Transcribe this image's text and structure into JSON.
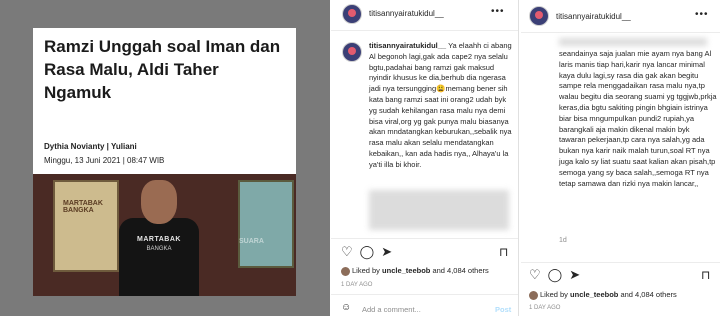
{
  "article": {
    "headline": "Ramzi Unggah soal Iman dan Rasa Malu, Aldi Taher Ngamuk",
    "byline": "Dythia Novianty | Yuliani",
    "date": "Minggu, 13 Juni 2021 | 08:47 WIB",
    "shirt_text": "MARTABAK",
    "shirt_sub": "BANGKA",
    "watermark": "SUARA",
    "poster_title": "MARTABAK BANGKA"
  },
  "post1": {
    "username": "titisannyairatukidul__",
    "caption_user": "titisannyairatukidul__",
    "caption": "Ya elaahh ci abang Al begonoh lagi,gak ada cape2 nya selalu bgtu,padahai bang ramzi gak maksud nyindir khusus ke dia,berhub dia ngerasa jadi nya tersungging😩memang bener sih kata bang ramzi saat ini orang2 udah byk yg sudah kehilangan rasa malu nya demi bisa viral,org yg gak punya malu biasanya akan mndatangkan keburukan,,sebalik nya rasa malu akan selalu mendatangkan kebaikan,, kan ada hadis nya,, Alhaya'u la ya'ti illa bi khoir.",
    "likes_user": "uncle_teebob",
    "likes_rest": " and 4,084 others",
    "likes_prefix": "Liked by ",
    "time_ago": "1 DAY AGO",
    "comment_placeholder": "Add a comment...",
    "post_label": "Post"
  },
  "post2": {
    "username": "titisannyairatukidul__",
    "caption": "seandainya saja jualan mie ayam nya bang Al laris manis tiap hari,karir nya lancar minimal kaya dulu lagi,sy rasa dia gak akan begitu sampe rela menggadaikan rasa malu nya,tp walau begitu dia seorang suami yg tggjwb,prkja keras,dia bgtu sakiting pingin bhgiain istrinya biar bisa mngumpulkan pundi2 rupiah,ya barangkali aja makin dikenal makin byk tawaran pekerjaan,tp cara nya salah,yg ada bukan nya karir naik malah turun,soal RT nya juga kalo sy liat suatu saat kalian akan pisah,tp semoga yang sy baca salah,,semoga RT nya tetap samawa dan rizki nya makin lancar,,",
    "comment_age": "1d",
    "likes_user": "uncle_teebob",
    "likes_rest": " and 4,084 others",
    "likes_prefix": "Liked by ",
    "time_ago": "1 DAY AGO"
  },
  "icons": {
    "more": "•••",
    "heart": "♡",
    "comment": "◯",
    "share": "➤",
    "bookmark": "⊓",
    "smile": "☺"
  }
}
